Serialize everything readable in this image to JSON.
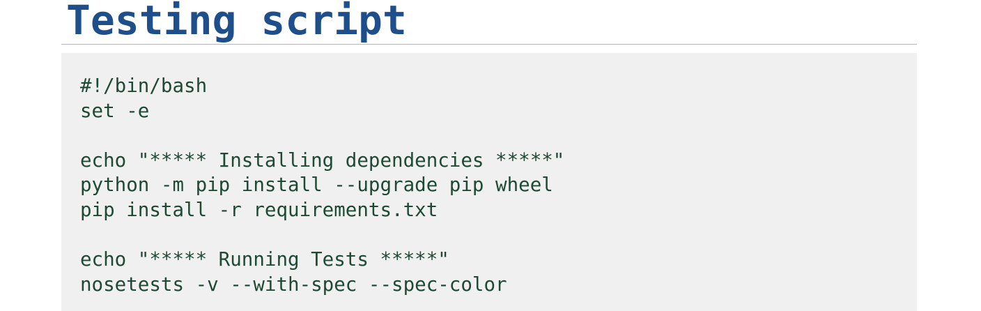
{
  "slide": {
    "title": "Testing script"
  },
  "code_block": {
    "lines": [
      "#!/bin/bash",
      "set -e",
      "",
      "echo \"***** Installing dependencies *****\"",
      "python -m pip install --upgrade pip wheel",
      "pip install -r requirements.txt",
      "",
      "echo \"***** Running Tests *****\"",
      "nosetests -v --with-spec --spec-color"
    ]
  },
  "colors": {
    "title": "#1f4f8a",
    "code_text": "#1e4a35",
    "code_background": "#f0f0f0",
    "rule": "#a8b8cc"
  }
}
